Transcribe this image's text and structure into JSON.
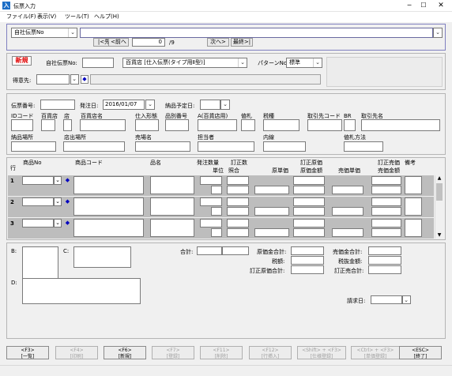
{
  "window": {
    "title": "伝票入力",
    "icon_text": "入"
  },
  "menu": [
    "ファイル(F)",
    "表示(V)",
    "ツール(T)",
    "ヘルプ(H)"
  ],
  "search": {
    "mode_select": "自社伝票No",
    "nav_first": "|<先頭",
    "nav_prev": "<前へ",
    "page_current": "0",
    "page_total": "/9",
    "nav_next": "次へ>",
    "nav_last": "最終>|"
  },
  "header": {
    "new_badge": "新規",
    "slip_no_label": "自社伝票No:",
    "slip_type": "百貨店 [仕入伝票(タイプ用Ⅱ型)]",
    "pattern_label": "パターンNo:",
    "pattern_value": "標準",
    "customer_label": "得意先:"
  },
  "order": {
    "order_no_label": "伝票番号:",
    "order_date_label": "発注日:",
    "order_date_value": "2016/01/07",
    "delivery_date_label": "納品予定日:",
    "fields_row1": [
      "IDコード",
      "百貨店",
      "店",
      "百貨店名",
      "仕入形態",
      "品別番号",
      "A(百貨店用)",
      "値札",
      "税種",
      "取引先コード",
      "BR",
      "取引先名"
    ],
    "fields_row2": [
      "納品場所",
      "店出場所",
      "売場名",
      "担当者",
      "内線",
      "値札方法"
    ]
  },
  "grid": {
    "headers": {
      "row": "行",
      "item_no": "商品No",
      "item_code": "商品コード",
      "item_name": "品名",
      "order_qty": "発注数量",
      "unit": "単位",
      "corrected_qty": "訂正数",
      "inspection": "照合",
      "cost_price": "原単価",
      "corrected_cost": "訂正原価",
      "cost_amount": "原価金額",
      "sell_price": "売価単価",
      "corrected_sell": "訂正売価",
      "sell_amount": "売価金額",
      "remarks": "備考"
    },
    "rows": [
      "1",
      "2",
      "3"
    ]
  },
  "footer": {
    "b_label": "B:",
    "c_label": "C:",
    "d_label": "D:",
    "total_label": "合計:",
    "cost_total_label": "原価金合計:",
    "tax_label": "税額:",
    "corrected_cost_total_label": "訂正原価合計:",
    "sell_total_label": "売価金合計:",
    "tax_excl_label": "税抜金額:",
    "corrected_sell_total_label": "訂正売合計:",
    "billing_date_label": "請求日:"
  },
  "fkeys": [
    {
      "key": "<F3>",
      "label": "[一覧]",
      "enabled": true
    },
    {
      "key": "<F4>",
      "label": "[印刷]",
      "enabled": false
    },
    {
      "key": "<F6>",
      "label": "[新規]",
      "enabled": true
    },
    {
      "key": "<F7>",
      "label": "[登録]",
      "enabled": false
    },
    {
      "key": "<F11>",
      "label": "[削除]",
      "enabled": false
    },
    {
      "key": "<F12>",
      "label": "[行挿入]",
      "enabled": false
    },
    {
      "key": "<Shift> + <F3>",
      "label": "[仕様登録]",
      "enabled": false
    },
    {
      "key": "<Ctrl> + <F3>",
      "label": "[単価登録]",
      "enabled": false
    },
    {
      "key": "<ESC>",
      "label": "[終了]",
      "enabled": true
    }
  ]
}
